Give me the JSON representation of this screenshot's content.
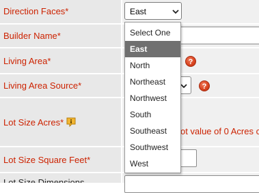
{
  "form": {
    "rows": [
      {
        "label": "Direction Faces*"
      },
      {
        "label": "Builder Name*"
      },
      {
        "label": "Living Area*"
      },
      {
        "label": "Living Area Source*"
      },
      {
        "label": "Lot Size Acres*"
      },
      {
        "label": "Lot Size Square Feet*"
      },
      {
        "label": "Lot Size Dimensions"
      }
    ],
    "direction_select_value": "East",
    "help_glyph": "?",
    "lot_size_note": "ot value of 0 Acres c"
  },
  "dropdown": {
    "options": [
      "Select One",
      "East",
      "North",
      "Northeast",
      "Northwest",
      "South",
      "Southeast",
      "Southwest",
      "West"
    ],
    "selected": "East"
  },
  "colors": {
    "label_red": "#cc2200",
    "label_bg": "#e8e8e8",
    "value_bg": "#f0f0f0",
    "selected_bg": "#707070"
  }
}
